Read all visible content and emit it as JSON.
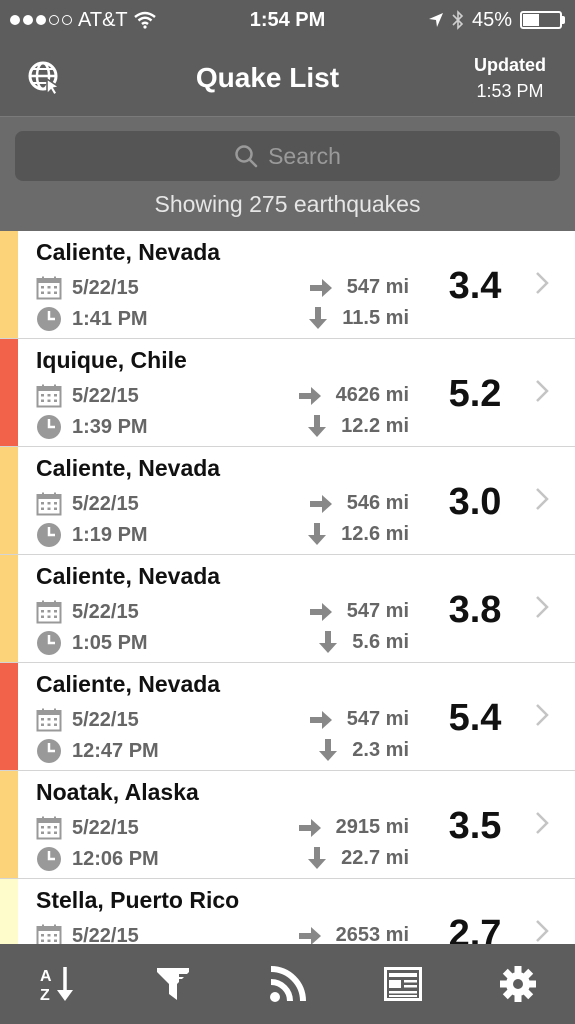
{
  "status_bar": {
    "carrier": "AT&T",
    "time": "1:54 PM",
    "battery_pct": "45%",
    "battery_level": 0.45
  },
  "nav": {
    "title": "Quake List",
    "updated_label": "Updated",
    "updated_time": "1:53 PM"
  },
  "search": {
    "placeholder": "Search",
    "showing_text": "Showing 275 earthquakes"
  },
  "colors": {
    "bar_bg": "#5d5d5d",
    "yellow": "#fdd37a",
    "red": "#f26149",
    "pale": "#fffccc"
  },
  "quakes": [
    {
      "place": "Caliente, Nevada",
      "date": "5/22/15",
      "time": "1:41 PM",
      "distance": "547 mi",
      "depth": "11.5 mi",
      "magnitude": "3.4",
      "color": "#fdd37a"
    },
    {
      "place": "Iquique, Chile",
      "date": "5/22/15",
      "time": "1:39 PM",
      "distance": "4626 mi",
      "depth": "12.2 mi",
      "magnitude": "5.2",
      "color": "#f26149"
    },
    {
      "place": "Caliente, Nevada",
      "date": "5/22/15",
      "time": "1:19 PM",
      "distance": "546 mi",
      "depth": "12.6 mi",
      "magnitude": "3.0",
      "color": "#fdd37a"
    },
    {
      "place": "Caliente, Nevada",
      "date": "5/22/15",
      "time": "1:05 PM",
      "distance": "547 mi",
      "depth": "5.6 mi",
      "magnitude": "3.8",
      "color": "#fdd37a"
    },
    {
      "place": "Caliente, Nevada",
      "date": "5/22/15",
      "time": "12:47 PM",
      "distance": "547 mi",
      "depth": "2.3 mi",
      "magnitude": "5.4",
      "color": "#f26149"
    },
    {
      "place": "Noatak, Alaska",
      "date": "5/22/15",
      "time": "12:06 PM",
      "distance": "2915 mi",
      "depth": "22.7 mi",
      "magnitude": "3.5",
      "color": "#fdd37a"
    },
    {
      "place": "Stella, Puerto Rico",
      "date": "5/22/15",
      "time": "",
      "distance": "2653 mi",
      "depth": "",
      "magnitude": "2.7",
      "color": "#fffccc"
    }
  ],
  "icons": {
    "nav_left": "globe-cursor-icon",
    "tabs": [
      "sort-az-icon",
      "filter-icon",
      "rss-icon",
      "news-icon",
      "gear-icon"
    ]
  }
}
